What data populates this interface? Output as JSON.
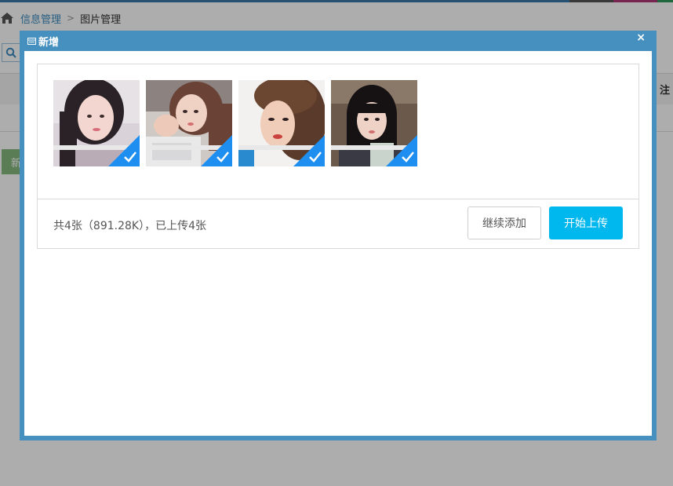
{
  "breadcrumb": {
    "home_icon": "home-icon",
    "link": "信息管理",
    "separator": ">",
    "current": "图片管理"
  },
  "background": {
    "table_header_note": "注",
    "new_button_label": "新"
  },
  "dialog": {
    "title": "新增",
    "close_label": "×"
  },
  "uploader": {
    "files": [
      {
        "status": "success",
        "progress": 1.0
      },
      {
        "status": "success",
        "progress": 1.0
      },
      {
        "status": "success",
        "progress": 1.0
      },
      {
        "status": "success",
        "progress": 1.0
      }
    ],
    "info_text": "共4张（891.28K），已上传4张",
    "continue_label": "继续添加",
    "start_label": "开始上传"
  },
  "colors": {
    "dialog_frame": "#4590bf",
    "start_button": "#00b7ee",
    "success_badge": "#1e8ff0"
  }
}
